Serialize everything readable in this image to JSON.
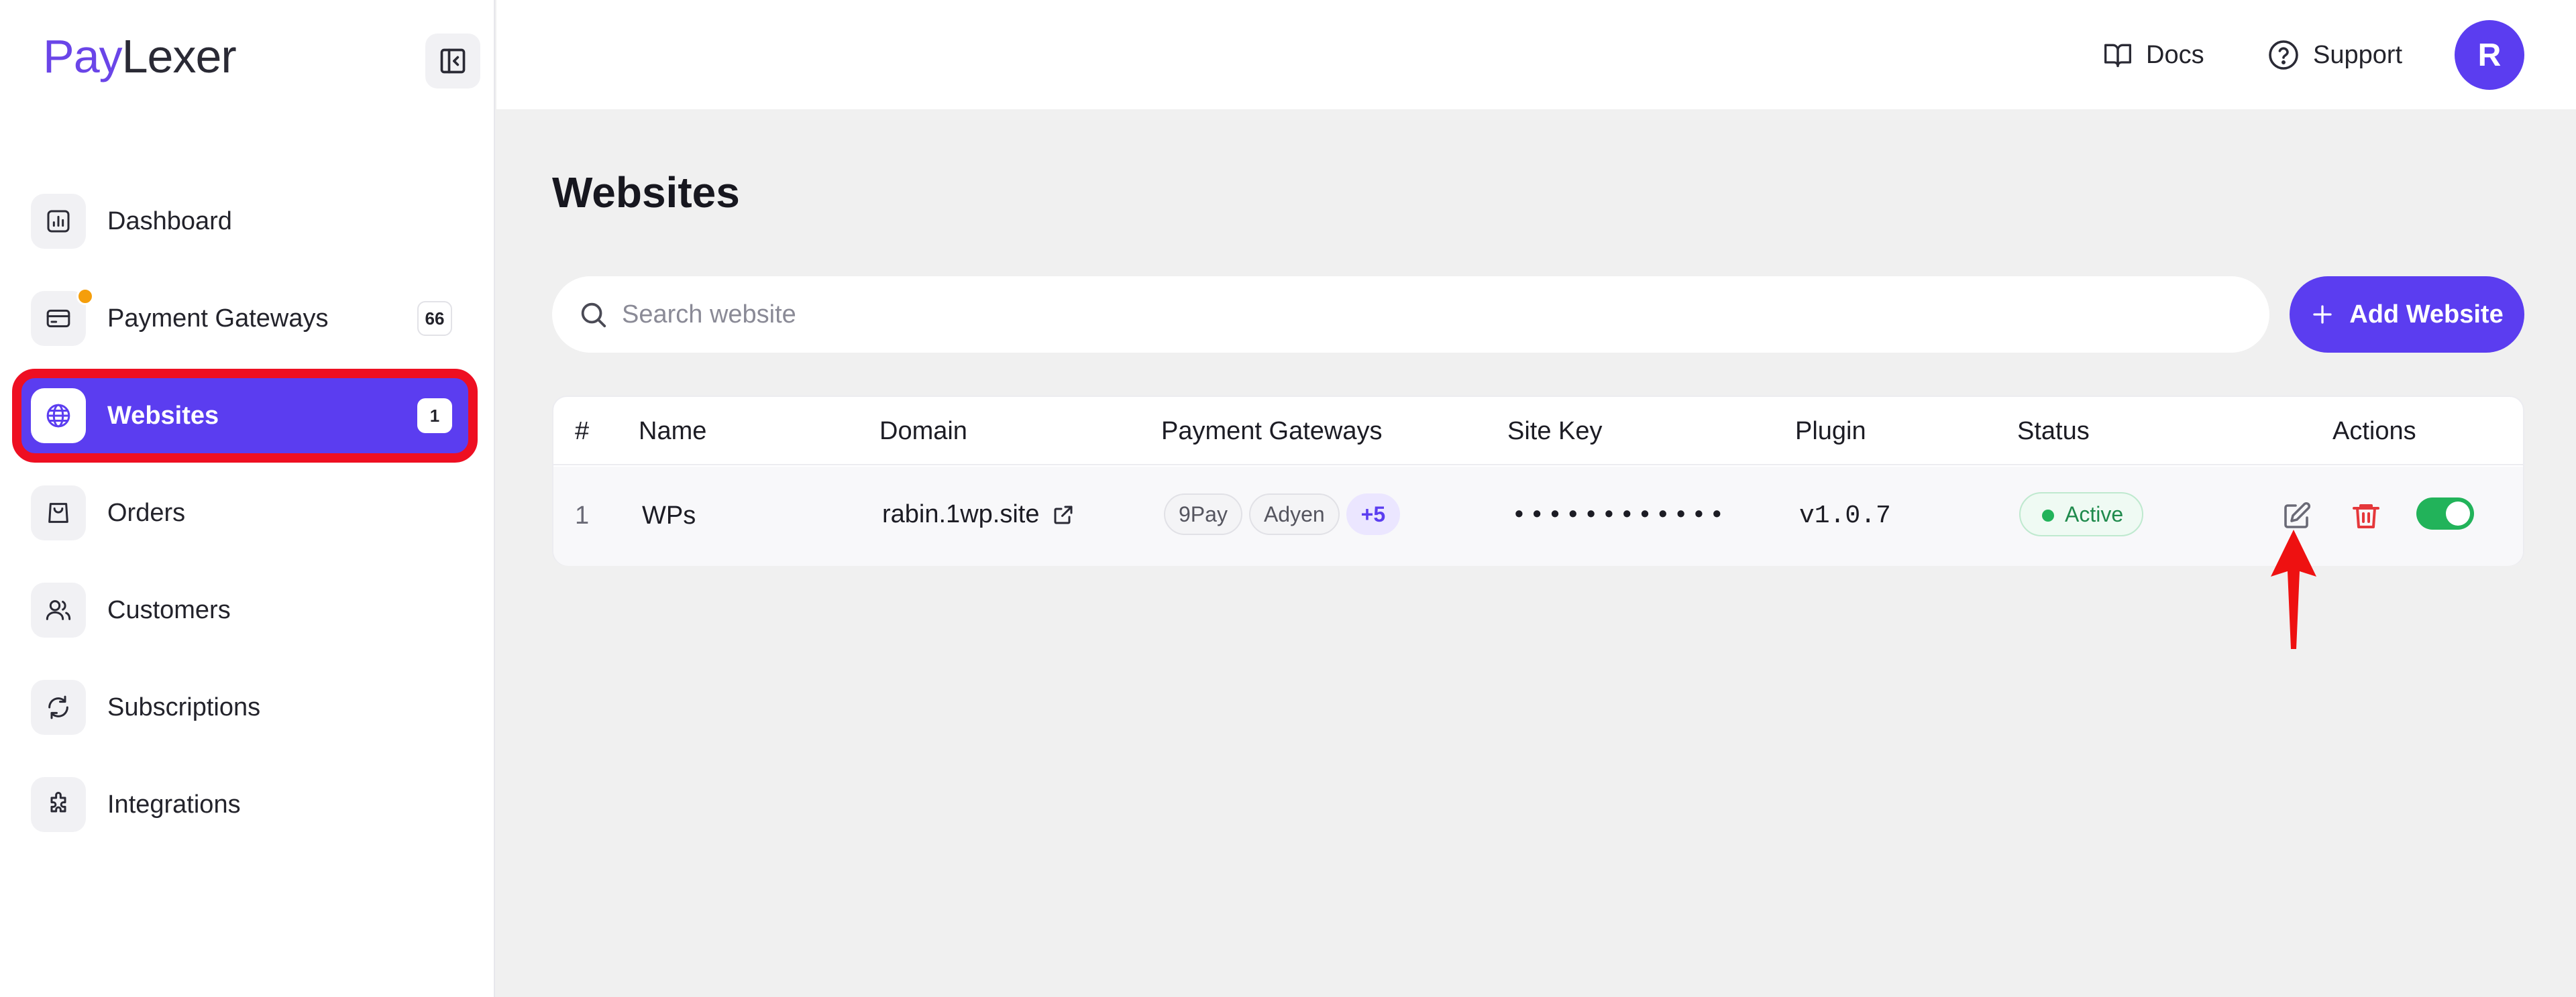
{
  "brand": {
    "part1": "Pay",
    "part2": "Lexer"
  },
  "sidebar": {
    "items": [
      {
        "label": "Dashboard",
        "icon": "chart-icon"
      },
      {
        "label": "Payment Gateways",
        "icon": "card-icon",
        "count": "66",
        "notify_color": "#f59e0b"
      },
      {
        "label": "Websites",
        "icon": "globe-icon",
        "count": "1",
        "active": true
      },
      {
        "label": "Orders",
        "icon": "bag-icon"
      },
      {
        "label": "Customers",
        "icon": "users-icon"
      },
      {
        "label": "Subscriptions",
        "icon": "refresh-icon"
      },
      {
        "label": "Integrations",
        "icon": "puzzle-icon"
      }
    ]
  },
  "header": {
    "docs_label": "Docs",
    "support_label": "Support",
    "avatar_initial": "R"
  },
  "main": {
    "title": "Websites",
    "search": {
      "placeholder": "Search website",
      "value": ""
    },
    "add_button_label": "Add Website",
    "table": {
      "headers": [
        "#",
        "Name",
        "Domain",
        "Payment Gateways",
        "Site Key",
        "Plugin",
        "Status",
        "Actions"
      ],
      "rows": [
        {
          "index": "1",
          "name": "WPs",
          "domain": "rabin.1wp.site",
          "gateways": [
            "9Pay",
            "Adyen"
          ],
          "gateways_more": "+5",
          "site_key": "••••••••••••",
          "plugin": "v1.0.7",
          "status": "Active",
          "enabled": true
        }
      ]
    }
  },
  "colors": {
    "accent": "#5b3df0",
    "highlight": "#ee0f22",
    "success": "#22b35a",
    "danger": "#e5383b"
  }
}
